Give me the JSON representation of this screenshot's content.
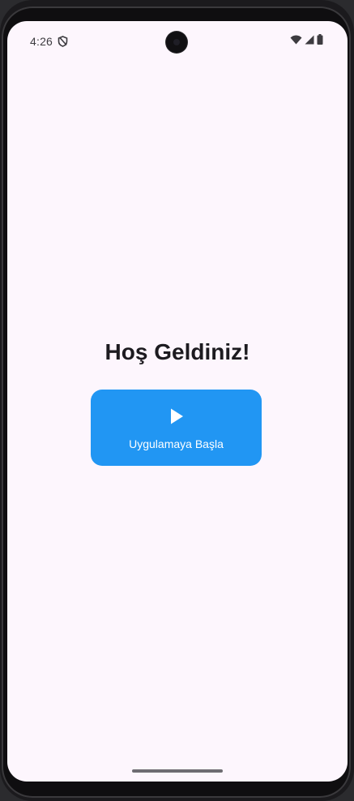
{
  "status_bar": {
    "time": "4:26",
    "icons": [
      "shield-icon",
      "wifi-icon",
      "cellular-signal-icon",
      "battery-icon"
    ]
  },
  "main": {
    "title": "Hoş Geldiniz!",
    "start_button": {
      "label": "Uygulamaya Başla",
      "icon": "play-icon",
      "background": "#2196f3",
      "text_color": "#ffffff"
    }
  },
  "colors": {
    "screen_background": "#fdf6fd",
    "title_text": "#1d1b20"
  }
}
